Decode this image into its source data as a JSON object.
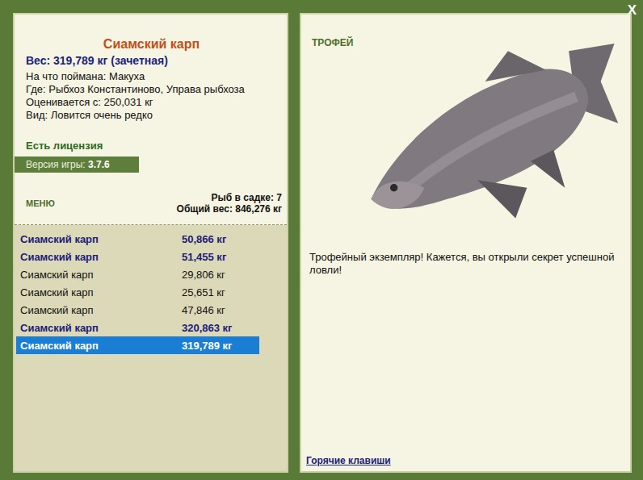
{
  "close": "X",
  "fish": {
    "title": "Сиамский карп",
    "weight": "Вес: 319,789 кг (зачетная)",
    "details": [
      "На что поймана: Макуха",
      "Где: Рыбхоз Константиново, Управа рыбхоза",
      "Оценивается с: 250,031 кг",
      "Вид: Ловится очень редко"
    ]
  },
  "license": "Есть лицензия",
  "version": {
    "label": "Версия игры:",
    "value": "3.7.6"
  },
  "menu": "МЕНЮ",
  "keepnet": {
    "count": "Рыб в садке: 7",
    "total": "Общий вес: 846,276 кг"
  },
  "catch": [
    {
      "name": "Сиамский карп",
      "weight": "50,866 кг",
      "trophy": true,
      "selected": false
    },
    {
      "name": "Сиамский карп",
      "weight": "51,455 кг",
      "trophy": true,
      "selected": false
    },
    {
      "name": "Сиамский карп",
      "weight": "29,806 кг",
      "trophy": false,
      "selected": false
    },
    {
      "name": "Сиамский карп",
      "weight": "25,651 кг",
      "trophy": false,
      "selected": false
    },
    {
      "name": "Сиамский карп",
      "weight": "47,846 кг",
      "trophy": false,
      "selected": false
    },
    {
      "name": "Сиамский карп",
      "weight": "320,863 кг",
      "trophy": true,
      "selected": false
    },
    {
      "name": "Сиамский карп",
      "weight": "319,789 кг",
      "trophy": true,
      "selected": true
    }
  ],
  "badge": "ТРОФЕЙ",
  "message": "Трофейный экземпляр! Кажется, вы открыли секрет успешной ловли!",
  "hotkeys": "Горячие клавиши"
}
